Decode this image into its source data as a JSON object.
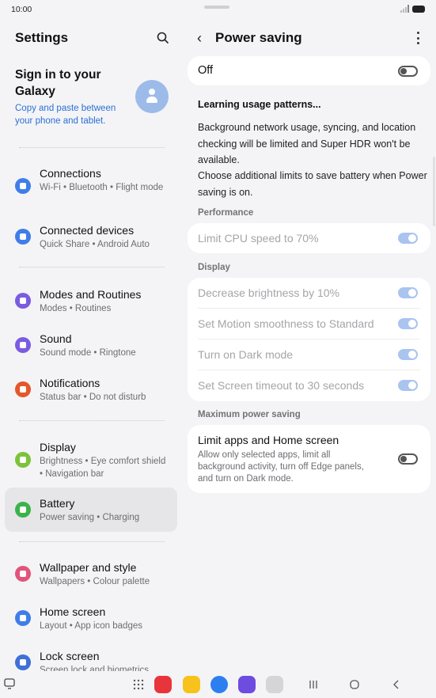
{
  "status": {
    "time": "10:00"
  },
  "settings": {
    "title": "Settings",
    "account": {
      "title": "Sign in to your Galaxy",
      "subtitle": "Copy and paste between your phone and tablet."
    },
    "items": [
      {
        "title": "Connections",
        "subtitle": "Wi-Fi  •  Bluetooth  •  Flight mode",
        "icon": "wifi-icon",
        "color": "#3f7ee8"
      },
      {
        "title": "Connected devices",
        "subtitle": "Quick Share  •  Android Auto",
        "icon": "connected-devices-icon",
        "color": "#3f7ee8"
      },
      {
        "title": "Modes and Routines",
        "subtitle": "Modes  •  Routines",
        "icon": "modes-icon",
        "color": "#7b5ce0"
      },
      {
        "title": "Sound",
        "subtitle": "Sound mode  •  Ringtone",
        "icon": "sound-icon",
        "color": "#7b5ce0"
      },
      {
        "title": "Notifications",
        "subtitle": "Status bar  •  Do not disturb",
        "icon": "notification-icon",
        "color": "#e4572b"
      },
      {
        "title": "Display",
        "subtitle": "Brightness  •  Eye comfort shield  •  Navigation bar",
        "icon": "display-icon",
        "color": "#7cc33a"
      },
      {
        "title": "Battery",
        "subtitle": "Power saving  •  Charging",
        "icon": "battery-icon",
        "color": "#3cb34a"
      },
      {
        "title": "Wallpaper and style",
        "subtitle": "Wallpapers  •  Colour palette",
        "icon": "wallpaper-icon",
        "color": "#e1557a"
      },
      {
        "title": "Home screen",
        "subtitle": "Layout  •  App icon badges",
        "icon": "home-icon",
        "color": "#3f7ee8"
      },
      {
        "title": "Lock screen",
        "subtitle": "Screen lock and biometrics",
        "icon": "lock-icon",
        "color": "#3f6fd8"
      }
    ]
  },
  "power_saving": {
    "title": "Power saving",
    "master_label": "Off",
    "master_on": false,
    "learning": "Learning usage patterns...",
    "description": "Background network usage, syncing, and location checking will be limited and Super HDR won't be available.",
    "description2": "Choose additional limits to save battery when Power saving is on.",
    "performance_label": "Performance",
    "cpu_label": "Limit CPU speed to 70%",
    "display_label": "Display",
    "display_rows": [
      "Decrease brightness by 10%",
      "Set Motion smoothness to Standard",
      "Turn on Dark mode",
      "Set Screen timeout to 30 seconds"
    ],
    "max_label": "Maximum power saving",
    "max_title": "Limit apps and Home screen",
    "max_desc": "Allow only selected apps, limit all background activity, turn off Edge panels, and turn on Dark mode."
  }
}
